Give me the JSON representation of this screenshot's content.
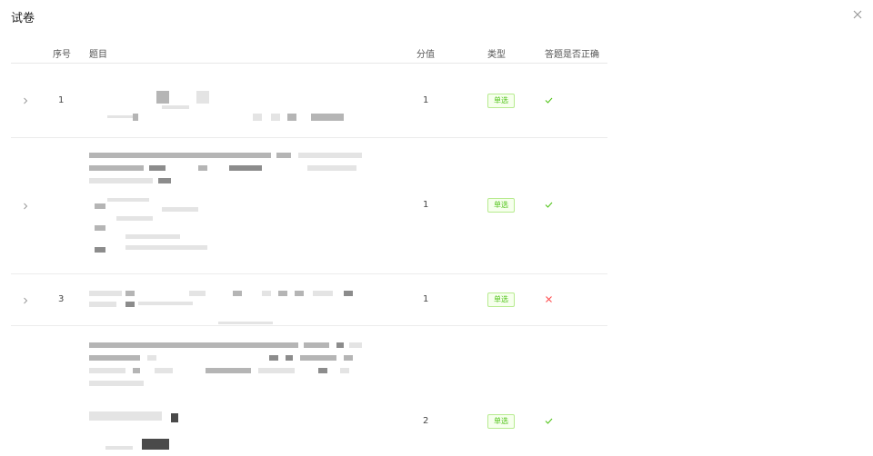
{
  "modal": {
    "title": "试卷"
  },
  "table": {
    "headers": {
      "index": "序号",
      "question": "题目",
      "score": "分值",
      "type": "类型",
      "correct": "答题是否正确"
    },
    "rows": [
      {
        "index": "1",
        "score": "1",
        "type": "单选",
        "correct": true
      },
      {
        "index": "",
        "score": "1",
        "type": "单选",
        "correct": true
      },
      {
        "index": "3",
        "score": "1",
        "type": "单选",
        "correct": false
      },
      {
        "index": "",
        "score": "2",
        "type": "单选",
        "correct": true
      }
    ]
  },
  "colors": {
    "tag_text": "#52c41a",
    "tag_bg": "#f6ffed",
    "tag_border": "#b7eb8f",
    "correct": "#52c41a",
    "wrong": "#ff4d4f"
  },
  "icons": {
    "close": "close-icon",
    "expand": "chevron-right-icon",
    "correct": "check-icon",
    "wrong": "x-icon"
  }
}
